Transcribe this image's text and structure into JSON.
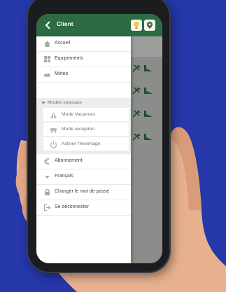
{
  "app": {
    "title": "Client"
  },
  "menu": {
    "items": [
      {
        "label": "Accueil",
        "icon": "home-icon"
      },
      {
        "label": "Equipements",
        "icon": "grid-icon"
      },
      {
        "label": "Météo",
        "icon": "cloud-icon"
      }
    ],
    "section": {
      "label": "Modes speciaux",
      "items": [
        {
          "label": "Mode Vacances",
          "icon": "beach-icon"
        },
        {
          "label": "Mode reception",
          "icon": "reception-icon"
        },
        {
          "label": "Activer l'hivernage",
          "icon": "power-icon"
        }
      ]
    },
    "bottom_items": [
      {
        "label": "Abonnement",
        "icon": "euro-icon"
      },
      {
        "label": "Français",
        "icon": "chevron-down-icon"
      },
      {
        "label": "Changer le mot de passe",
        "icon": "lock-icon"
      },
      {
        "label": "Se déconnecter",
        "icon": "logout-icon"
      }
    ]
  },
  "colors": {
    "appbar": "#2d6b43",
    "background": "#2537a9",
    "accent_icon": "#2d6b43"
  }
}
